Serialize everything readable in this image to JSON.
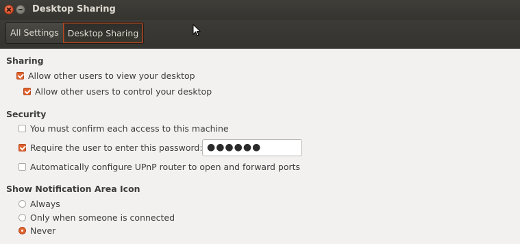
{
  "window": {
    "title": "Desktop Sharing"
  },
  "toolbar": {
    "crumbs": [
      "All Settings",
      "Desktop Sharing"
    ]
  },
  "sharing": {
    "title": "Sharing",
    "view_label": "Allow other users to view your desktop",
    "view_checked": true,
    "control_label": "Allow other users to control your desktop",
    "control_checked": true
  },
  "security": {
    "title": "Security",
    "confirm_label": "You must confirm each access to this machine",
    "confirm_checked": false,
    "password_label": "Require the user to enter this password:",
    "password_checked": true,
    "password_value": "●●●●●●",
    "upnp_label": "Automatically configure UPnP router to open and forward ports",
    "upnp_checked": false
  },
  "notification": {
    "title": "Show Notification Area Icon",
    "options": [
      "Always",
      "Only when someone is connected",
      "Never"
    ],
    "selected": "Never"
  },
  "colors": {
    "accent": "#e0632f",
    "titlebar": "#3c3b37",
    "background": "#f2f1f0"
  }
}
